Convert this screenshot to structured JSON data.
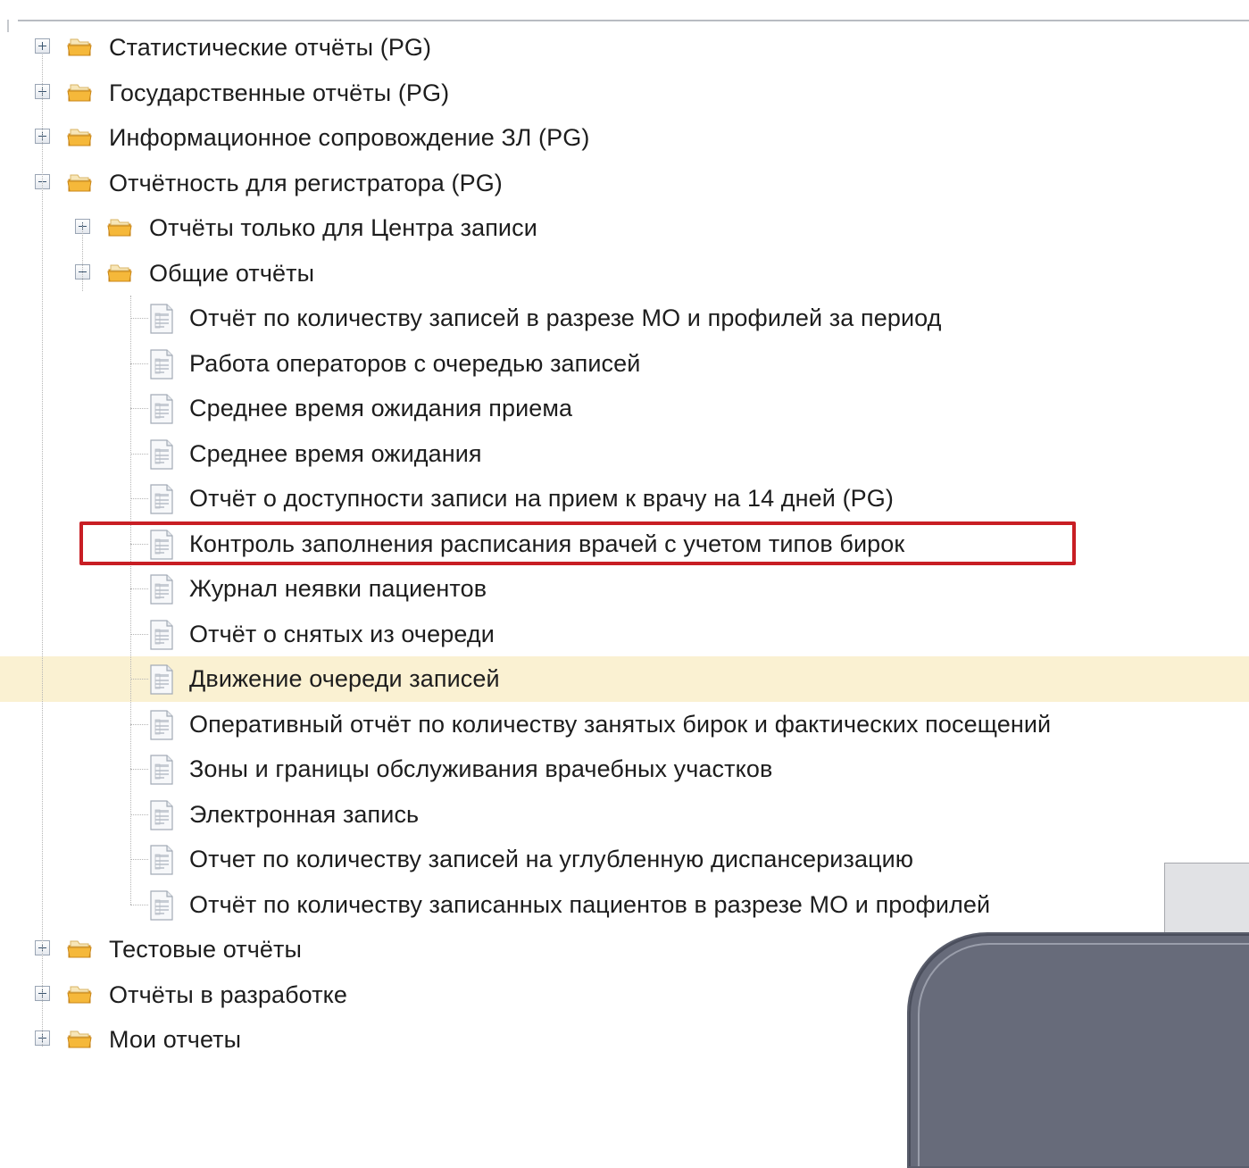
{
  "tree": {
    "nodes": [
      {
        "label": "Статистические отчёты (PG)",
        "type": "folder",
        "state": "collapsed",
        "level": 0
      },
      {
        "label": "Государственные отчёты (PG)",
        "type": "folder",
        "state": "collapsed",
        "level": 0
      },
      {
        "label": "Информационное сопровождение ЗЛ (PG)",
        "type": "folder",
        "state": "collapsed",
        "level": 0
      },
      {
        "label": "Отчётность для регистратора (PG)",
        "type": "folder",
        "state": "expanded",
        "level": 0
      },
      {
        "label": "Отчёты только для Центра записи",
        "type": "folder",
        "state": "collapsed",
        "level": 1
      },
      {
        "label": "Общие отчёты",
        "type": "folder",
        "state": "expanded",
        "level": 1
      },
      {
        "label": "Отчёт по количеству записей в разрезе МО и профилей за период",
        "type": "report",
        "level": 2
      },
      {
        "label": "Работа операторов с очередью записей",
        "type": "report",
        "level": 2
      },
      {
        "label": "Среднее время ожидания приема",
        "type": "report",
        "level": 2
      },
      {
        "label": "Среднее время ожидания",
        "type": "report",
        "level": 2
      },
      {
        "label": "Отчёт о доступности записи на прием к врачу на 14 дней (PG)",
        "type": "report",
        "level": 2
      },
      {
        "label": "Контроль заполнения расписания врачей с учетом типов бирок",
        "type": "report",
        "level": 2,
        "highlighted": true
      },
      {
        "label": "Журнал неявки пациентов",
        "type": "report",
        "level": 2
      },
      {
        "label": "Отчёт о снятых из очереди",
        "type": "report",
        "level": 2
      },
      {
        "label": "Движение очереди записей",
        "type": "report",
        "level": 2,
        "selected": true
      },
      {
        "label": "Оперативный отчёт по количеству занятых бирок и фактических посещений",
        "type": "report",
        "level": 2
      },
      {
        "label": "Зоны и границы обслуживания врачебных участков",
        "type": "report",
        "level": 2
      },
      {
        "label": "Электронная запись",
        "type": "report",
        "level": 2
      },
      {
        "label": "Отчет по количеству записей на углубленную диспансеризацию",
        "type": "report",
        "level": 2
      },
      {
        "label": "Отчёт по количеству записанных пациентов в разрезе МО и профилей",
        "type": "report",
        "level": 2,
        "last": true
      },
      {
        "label": "Тестовые отчёты",
        "type": "folder",
        "state": "collapsed",
        "level": 0
      },
      {
        "label": "Отчёты в разработке",
        "type": "folder",
        "state": "collapsed",
        "level": 0
      },
      {
        "label": "Мои отчеты",
        "type": "folder",
        "state": "collapsed",
        "level": 0
      }
    ]
  },
  "icons": {
    "folder": "folder-icon",
    "report": "report-document-icon",
    "expand": "expand-plus-icon",
    "collapse": "collapse-minus-icon"
  },
  "colors": {
    "selected_row": "#faf1d2",
    "highlight_border": "#c81e24",
    "folder_fill": "#f3b233",
    "overlay_dark": "#676b7a",
    "overlay_light": "#e1e2e5"
  }
}
